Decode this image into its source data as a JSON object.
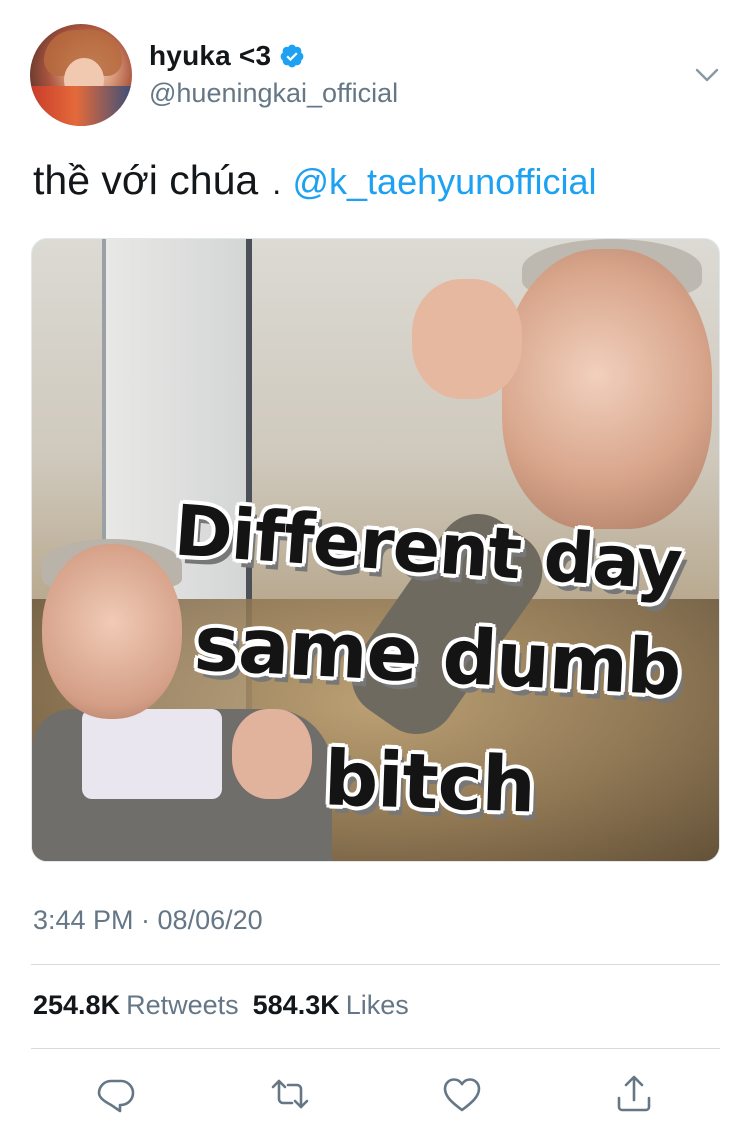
{
  "tweet": {
    "author": {
      "display_name": "hyuka <3",
      "handle": "@hueningkai_official",
      "verified": true
    },
    "text": "thề với chúa",
    "separator": ".",
    "mention": "@k_taehyunofficial",
    "image": {
      "caption_line_1": "Different day",
      "caption_line_2": "same dumb",
      "caption_line_3": "bitch"
    },
    "timestamp": "3:44 PM · 08/06/20",
    "stats": {
      "retweets_count": "254.8K",
      "retweets_label": "Retweets",
      "likes_count": "584.3K",
      "likes_label": "Likes"
    },
    "actions": [
      {
        "icon": "reply-icon"
      },
      {
        "icon": "retweet-icon"
      },
      {
        "icon": "heart-icon"
      },
      {
        "icon": "share-icon"
      }
    ]
  },
  "colors": {
    "accent": "#1da1f2",
    "text_primary": "#14171a",
    "text_secondary": "#657786",
    "divider": "#d5dbe0"
  }
}
